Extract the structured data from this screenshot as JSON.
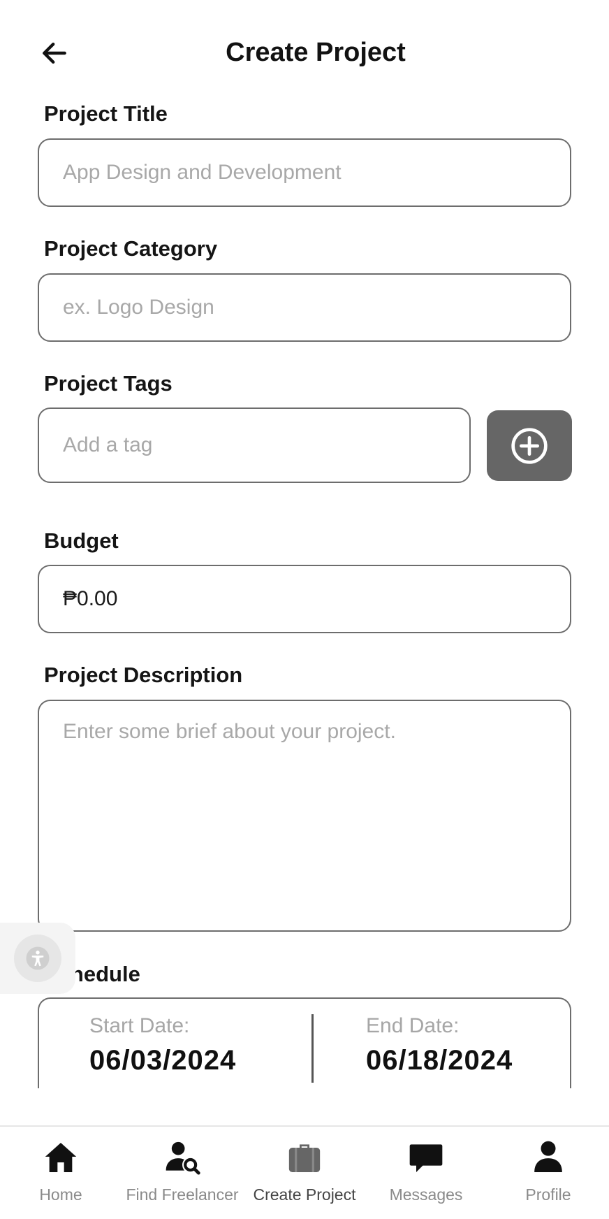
{
  "header": {
    "title": "Create Project",
    "back_icon": "arrow-left-icon"
  },
  "form": {
    "title_label": "Project Title",
    "title_placeholder": "App Design and Development",
    "category_label": "Project Category",
    "category_placeholder": "ex. Logo Design",
    "tags_label": "Project Tags",
    "tags_placeholder": "Add a tag",
    "tags_add_icon": "plus-circle-icon",
    "budget_label": "Budget",
    "budget_value": "₱0.00",
    "description_label": "Project Description",
    "description_placeholder": "Enter some brief about your project.",
    "schedule_label": "Schedule",
    "start_date_caption": "Start Date:",
    "start_date_value": "06/03/2024",
    "end_date_caption": "End Date:",
    "end_date_value": "06/18/2024"
  },
  "accessibility_button": {
    "icon": "accessibility-icon"
  },
  "bottom_nav": {
    "items": [
      {
        "label": "Home",
        "icon": "home-icon"
      },
      {
        "label": "Find Freelancer",
        "icon": "user-search-icon"
      },
      {
        "label": "Create Project",
        "icon": "briefcase-icon"
      },
      {
        "label": "Messages",
        "icon": "chat-bubble-icon"
      },
      {
        "label": "Profile",
        "icon": "person-icon"
      }
    ]
  },
  "colors": {
    "text": "#111111",
    "placeholder": "#a8a8a8",
    "border": "#6d6d6d",
    "add_button": "#666666",
    "nav_label": "#8a8a8a"
  }
}
